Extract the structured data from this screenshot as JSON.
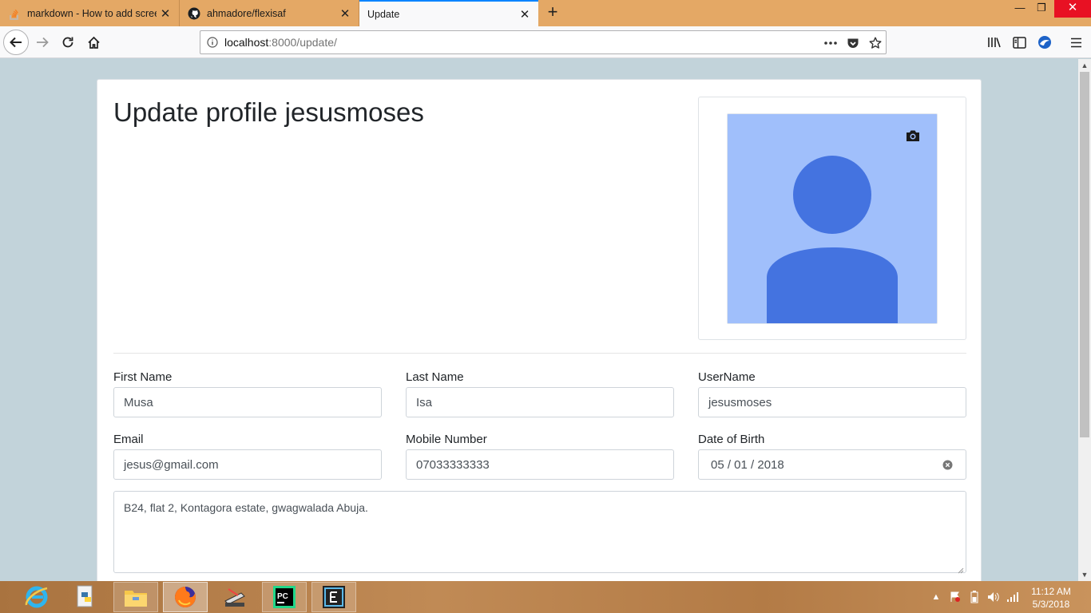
{
  "browser": {
    "tabs": [
      {
        "title": "markdown - How to add screen",
        "icon": "stackoverflow-icon",
        "active": false
      },
      {
        "title": "ahmadore/flexisaf",
        "icon": "github-icon",
        "active": false
      },
      {
        "title": "Update",
        "icon": "none",
        "active": true
      }
    ],
    "url_host": "localhost",
    "url_rest": ":8000/update/",
    "window_controls": {
      "minimize": "—",
      "restore": "❐",
      "close": "✕"
    }
  },
  "page": {
    "title": "Update profile jesusmoses",
    "fields": {
      "first_name": {
        "label": "First Name",
        "value": "Musa"
      },
      "last_name": {
        "label": "Last Name",
        "value": "Isa"
      },
      "username": {
        "label": "UserName",
        "value": "jesusmoses"
      },
      "email": {
        "label": "Email",
        "value": "jesus@gmail.com"
      },
      "mobile": {
        "label": "Mobile Number",
        "value": "07033333333"
      },
      "dob": {
        "label": "Date of Birth",
        "value": "05 / 01 / 2018"
      }
    },
    "address": "B24, flat 2, Kontagora estate, gwagwalada Abuja."
  },
  "taskbar": {
    "clock_time": "11:12 AM",
    "clock_date": "5/3/2018",
    "apps": [
      "ie-icon",
      "python-icon",
      "file-explorer-icon",
      "firefox-icon",
      "scanner-icon",
      "pycharm-icon",
      "editor-icon"
    ]
  },
  "colors": {
    "tab_strip": "#e4a865",
    "page_bg": "#c2d3da",
    "avatar_bg": "#a0bffb",
    "avatar_fg": "#4473e0",
    "accent": "#0a84ff"
  }
}
